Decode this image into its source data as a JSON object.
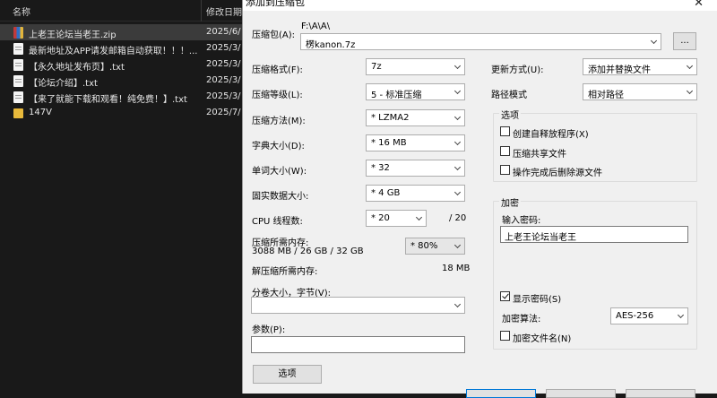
{
  "explorer": {
    "col_name": "名称",
    "col_date": "修改日期",
    "rows": [
      {
        "name": "上老王论坛当老王.zip",
        "date": "2025/6/",
        "type": "zip"
      },
      {
        "name": "最新地址及APP请发邮箱自动获取！！！....",
        "date": "2025/3/",
        "type": "doc"
      },
      {
        "name": "【永久地址发布页】.txt",
        "date": "2025/3/",
        "type": "doc"
      },
      {
        "name": "【论坛介绍】.txt",
        "date": "2025/3/",
        "type": "doc"
      },
      {
        "name": "【来了就能下载和观看！纯免费！】.txt",
        "date": "2025/3/",
        "type": "doc"
      },
      {
        "name": "147V",
        "date": "2025/7/",
        "type": "folder"
      }
    ]
  },
  "dialog": {
    "title": "添加到压缩包",
    "close": "✕",
    "archive_label": "压缩包(A):",
    "archive_path": "F:\\A\\A\\",
    "archive_name": "楞kanon.7z",
    "browse_label": "...",
    "format_label": "压缩格式(F):",
    "format_value": "7z",
    "level_label": "压缩等级(L):",
    "level_value": "5 - 标准压缩",
    "method_label": "压缩方法(M):",
    "method_value": "* LZMA2",
    "dict_label": "字典大小(D):",
    "dict_value": "* 16 MB",
    "word_label": "单词大小(W):",
    "word_value": "* 32",
    "solid_label": "固实数据大小:",
    "solid_value": "* 4 GB",
    "cpu_label": "CPU 线程数:",
    "cpu_value": "* 20",
    "cpu_total": "/ 20",
    "mem_comp_label": "压缩所需内存:",
    "mem_comp_value": "3088 MB / 26 GB / 32 GB",
    "mem_percent_value": "* 80%",
    "mem_decomp_label": "解压缩所需内存:",
    "mem_decomp_value": "18 MB",
    "volume_label": "分卷大小，字节(V):",
    "volume_value": "",
    "params_label": "参数(P):",
    "params_value": "",
    "options_button": "选项",
    "update_label": "更新方式(U):",
    "update_value": "添加并替换文件",
    "path_label": "路径模式",
    "path_value": "相对路径",
    "options_group_title": "选项",
    "opt_sfx": "创建自释放程序(X)",
    "opt_shared": "压缩共享文件",
    "opt_delete": "操作完成后删除源文件",
    "encrypt_group_title": "加密",
    "password_label": "输入密码:",
    "password_value": "上老王论坛当老王",
    "show_password": "显示密码(S)",
    "enc_method_label": "加密算法:",
    "enc_method_value": "AES-256",
    "enc_names": "加密文件名(N)"
  }
}
